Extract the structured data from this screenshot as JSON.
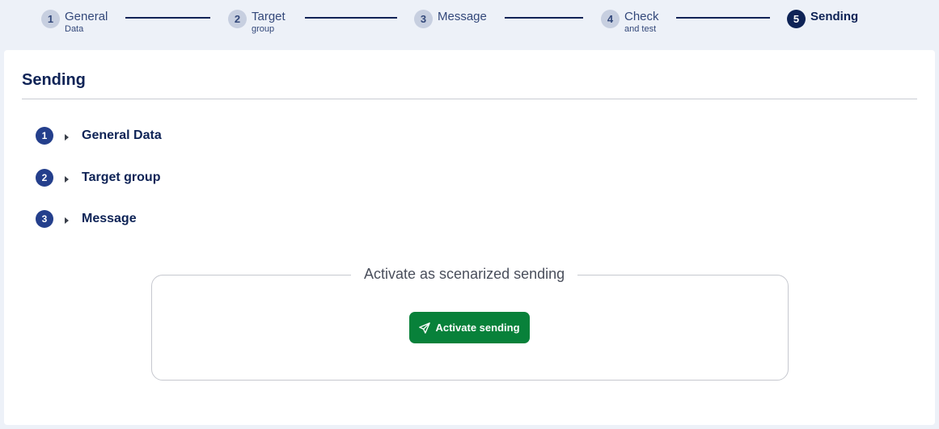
{
  "stepper": {
    "steps": [
      {
        "num": "1",
        "title": "General",
        "sub": "Data"
      },
      {
        "num": "2",
        "title": "Target",
        "sub": "group"
      },
      {
        "num": "3",
        "title": "Message",
        "sub": ""
      },
      {
        "num": "4",
        "title": "Check",
        "sub": "and test"
      },
      {
        "num": "5",
        "title": "Sending",
        "sub": ""
      }
    ],
    "active_step": "5"
  },
  "page": {
    "title": "Sending"
  },
  "sections": [
    {
      "num": "1",
      "label": "General Data"
    },
    {
      "num": "2",
      "label": "Target group"
    },
    {
      "num": "3",
      "label": "Message"
    }
  ],
  "activation": {
    "legend": "Activate as scenarized sending",
    "button_label": "Activate sending",
    "button_icon": "paper-plane-icon"
  },
  "colors": {
    "accent": "#0e2356",
    "step_badge": "#243f8c",
    "button": "#08813a",
    "background": "#edf1f8"
  }
}
